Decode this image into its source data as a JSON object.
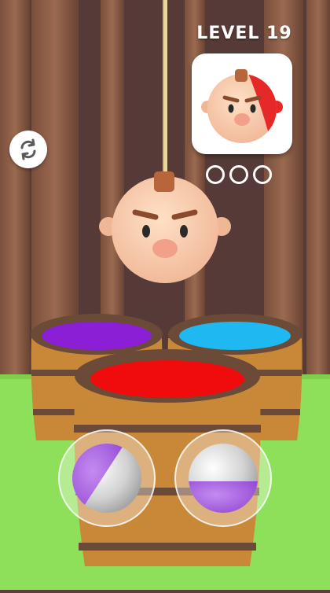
{
  "hud": {
    "level_text": "LEVEL 19",
    "progress_slots": 3,
    "progress_filled": 0
  },
  "colors": {
    "background_wall": "#5a3f3b",
    "pillar": "#8a5b45",
    "floor": "#8ee05a",
    "barrel_wood": "#c98838",
    "barrel_band": "#6b4a37",
    "paint_purple": "#8a1fd6",
    "paint_cyan": "#1fb8f0",
    "paint_red": "#f00c0c",
    "target_paint": "#e62828",
    "choice_purple": "#9b4fd6"
  },
  "buckets": [
    {
      "name": "purple-barrel",
      "color": "purple"
    },
    {
      "name": "cyan-barrel",
      "color": "cyan"
    },
    {
      "name": "red-barrel",
      "color": "red"
    }
  ],
  "choices": [
    {
      "name": "purple-diagonal-ball",
      "pattern": "diagonal-cap"
    },
    {
      "name": "purple-bottom-half-ball",
      "pattern": "bottom-half"
    }
  ],
  "icons": {
    "restart": "restart-icon",
    "progress": "progress-circle-icon"
  }
}
